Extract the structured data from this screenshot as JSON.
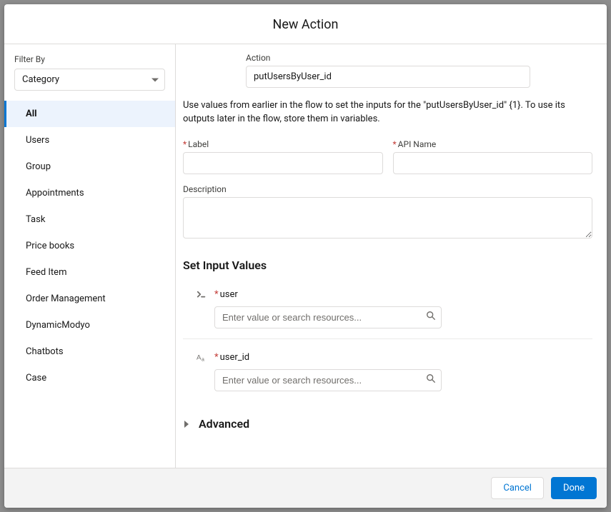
{
  "header": {
    "title": "New Action"
  },
  "sidebar": {
    "filter_label": "Filter By",
    "filter_value": "Category",
    "items": [
      {
        "label": "All",
        "active": true
      },
      {
        "label": "Users",
        "active": false
      },
      {
        "label": "Group",
        "active": false
      },
      {
        "label": "Appointments",
        "active": false
      },
      {
        "label": "Task",
        "active": false
      },
      {
        "label": "Price books",
        "active": false
      },
      {
        "label": "Feed Item",
        "active": false
      },
      {
        "label": "Order Management",
        "active": false
      },
      {
        "label": "DynamicModyo",
        "active": false
      },
      {
        "label": "Chatbots",
        "active": false
      },
      {
        "label": "Case",
        "active": false
      }
    ]
  },
  "main": {
    "action_label": "Action",
    "action_value": "putUsersByUser_id",
    "help_text": "Use values from earlier in the flow to set the inputs for the \"putUsersByUser_id\" {1}. To use its outputs later in the flow, store them in variables.",
    "label_label": "Label",
    "api_name_label": "API Name",
    "description_label": "Description",
    "section_title": "Set Input Values",
    "input_search_placeholder": "Enter value or search resources...",
    "inputs": [
      {
        "name": "user",
        "icon": "terminal"
      },
      {
        "name": "user_id",
        "icon": "text"
      }
    ],
    "advanced_label": "Advanced"
  },
  "footer": {
    "cancel": "Cancel",
    "done": "Done"
  }
}
